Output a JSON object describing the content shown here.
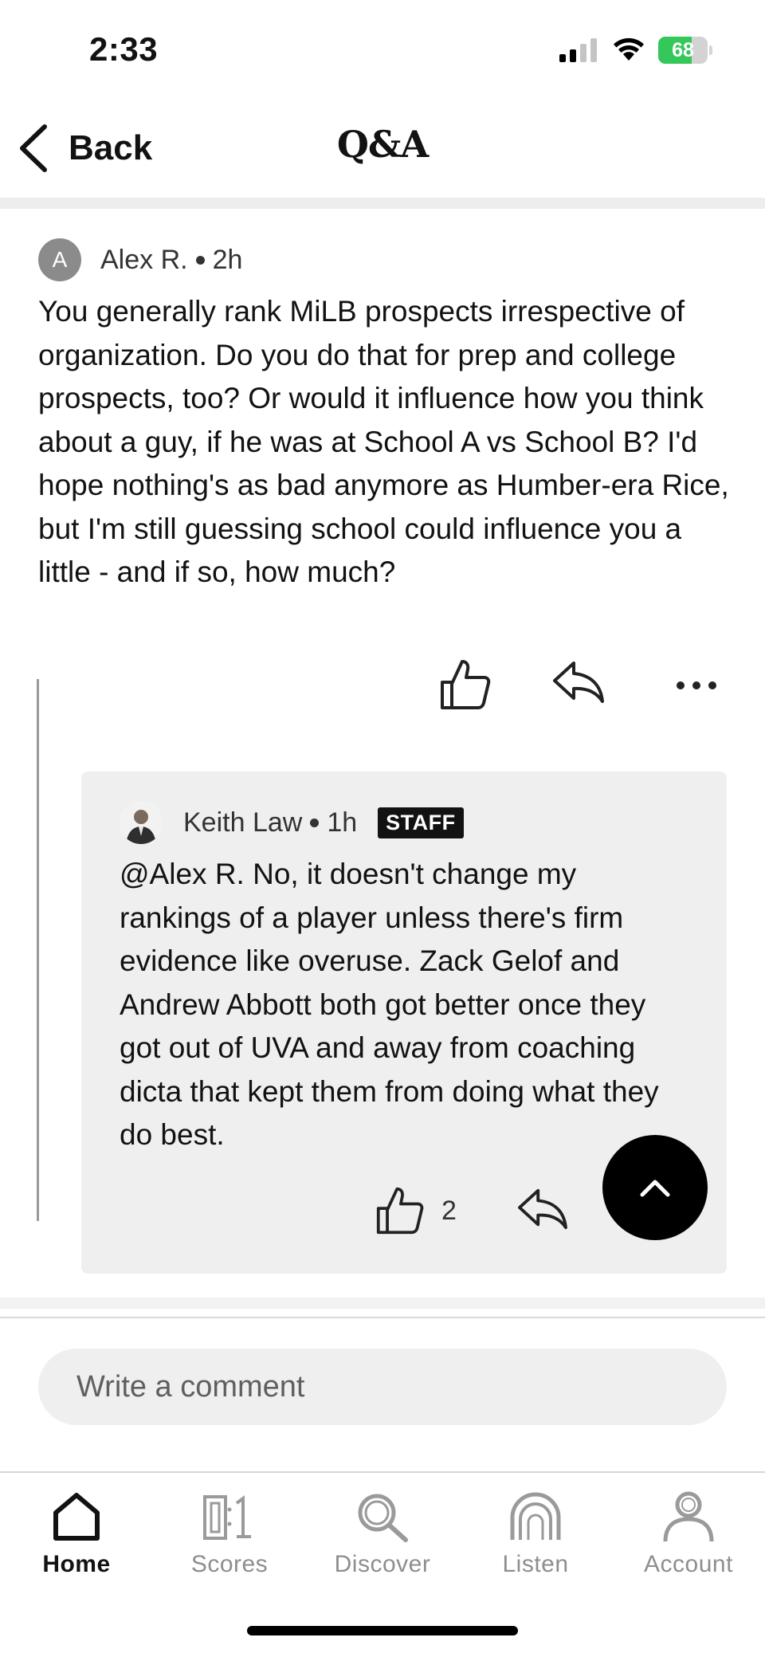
{
  "status_bar": {
    "time": "2:33",
    "battery_percent": "68",
    "battery_level": 0.68,
    "battery_color": "#34c759"
  },
  "nav": {
    "back_label": "Back",
    "title": "Q&A",
    "back_icon": "chevron-left-icon"
  },
  "question": {
    "avatar_letter": "A",
    "author": "Alex R.",
    "time": "2h",
    "text": "You generally rank MiLB prospects irrespective of organization. Do you do that for prep and college prospects, too? Or would it influence how you think about a guy, if he was at School A vs School B? I'd hope nothing's as bad anymore as Humber-era Rice, but I'm still guessing school could influence you a little - and if so, how much?",
    "actions": [
      "thumbs-up-icon",
      "reply-icon",
      "more-icon"
    ]
  },
  "reply": {
    "author": "Keith Law",
    "time": "1h",
    "badge": "STAFF",
    "text": "@Alex R. No, it doesn't change my rankings of a player unless there's firm evidence like overuse. Zack Gelof and Andrew Abbott both got better once they got out of UVA and away from coaching dicta that kept them from doing what they do best.",
    "likes": "2"
  },
  "comment_input": {
    "placeholder": "Write a comment"
  },
  "tab_bar": {
    "tabs": [
      {
        "label": "Home",
        "icon": "home-icon",
        "active": true
      },
      {
        "label": "Scores",
        "icon": "scores-icon",
        "active": false
      },
      {
        "label": "Discover",
        "icon": "search-icon",
        "active": false
      },
      {
        "label": "Listen",
        "icon": "headphones-icon",
        "active": false
      },
      {
        "label": "Account",
        "icon": "account-icon",
        "active": false
      }
    ]
  }
}
